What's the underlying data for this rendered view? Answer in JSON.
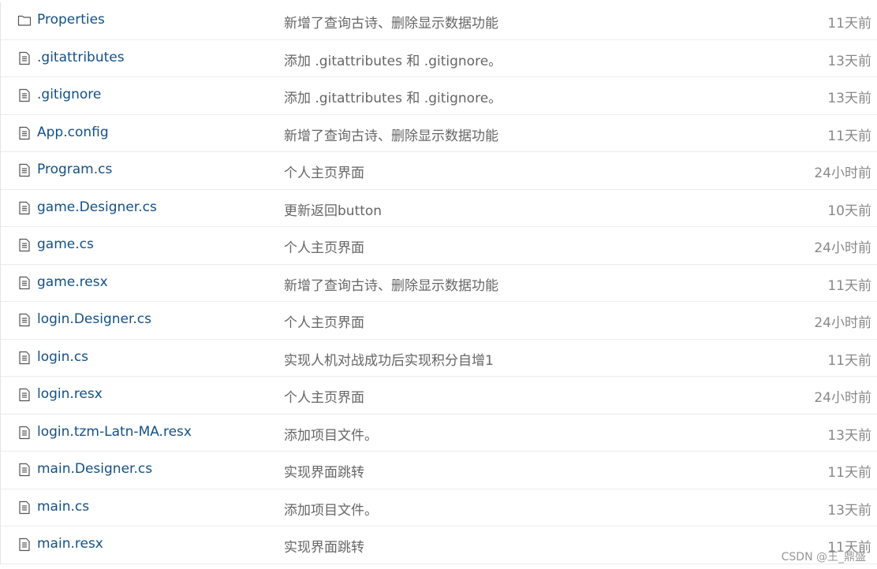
{
  "files": [
    {
      "icon": "folder-icon",
      "name": "Properties",
      "message": "新增了查询古诗、删除显示数据功能",
      "age": "11天前"
    },
    {
      "icon": "file-icon",
      "name": ".gitattributes",
      "message": "添加 .gitattributes 和 .gitignore。",
      "age": "13天前"
    },
    {
      "icon": "file-icon",
      "name": ".gitignore",
      "message": "添加 .gitattributes 和 .gitignore。",
      "age": "13天前"
    },
    {
      "icon": "file-icon",
      "name": "App.config",
      "message": "新增了查询古诗、删除显示数据功能",
      "age": "11天前"
    },
    {
      "icon": "file-icon",
      "name": "Program.cs",
      "message": "个人主页界面",
      "age": "24小时前"
    },
    {
      "icon": "file-icon",
      "name": "game.Designer.cs",
      "message": "更新返回button",
      "age": "10天前"
    },
    {
      "icon": "file-icon",
      "name": "game.cs",
      "message": "个人主页界面",
      "age": "24小时前"
    },
    {
      "icon": "file-icon",
      "name": "game.resx",
      "message": "新增了查询古诗、删除显示数据功能",
      "age": "11天前"
    },
    {
      "icon": "file-icon",
      "name": "login.Designer.cs",
      "message": "个人主页界面",
      "age": "24小时前"
    },
    {
      "icon": "file-icon",
      "name": "login.cs",
      "message": "实现人机对战成功后实现积分自增1",
      "age": "11天前"
    },
    {
      "icon": "file-icon",
      "name": "login.resx",
      "message": "个人主页界面",
      "age": "24小时前"
    },
    {
      "icon": "file-icon",
      "name": "login.tzm-Latn-MA.resx",
      "message": "添加项目文件。",
      "age": "13天前"
    },
    {
      "icon": "file-icon",
      "name": "main.Designer.cs",
      "message": "实现界面跳转",
      "age": "11天前"
    },
    {
      "icon": "file-icon",
      "name": "main.cs",
      "message": "添加项目文件。",
      "age": "13天前"
    },
    {
      "icon": "file-icon",
      "name": "main.resx",
      "message": "实现界面跳转",
      "age": "11天前"
    }
  ],
  "watermark": "CSDN @王_鼎盛"
}
